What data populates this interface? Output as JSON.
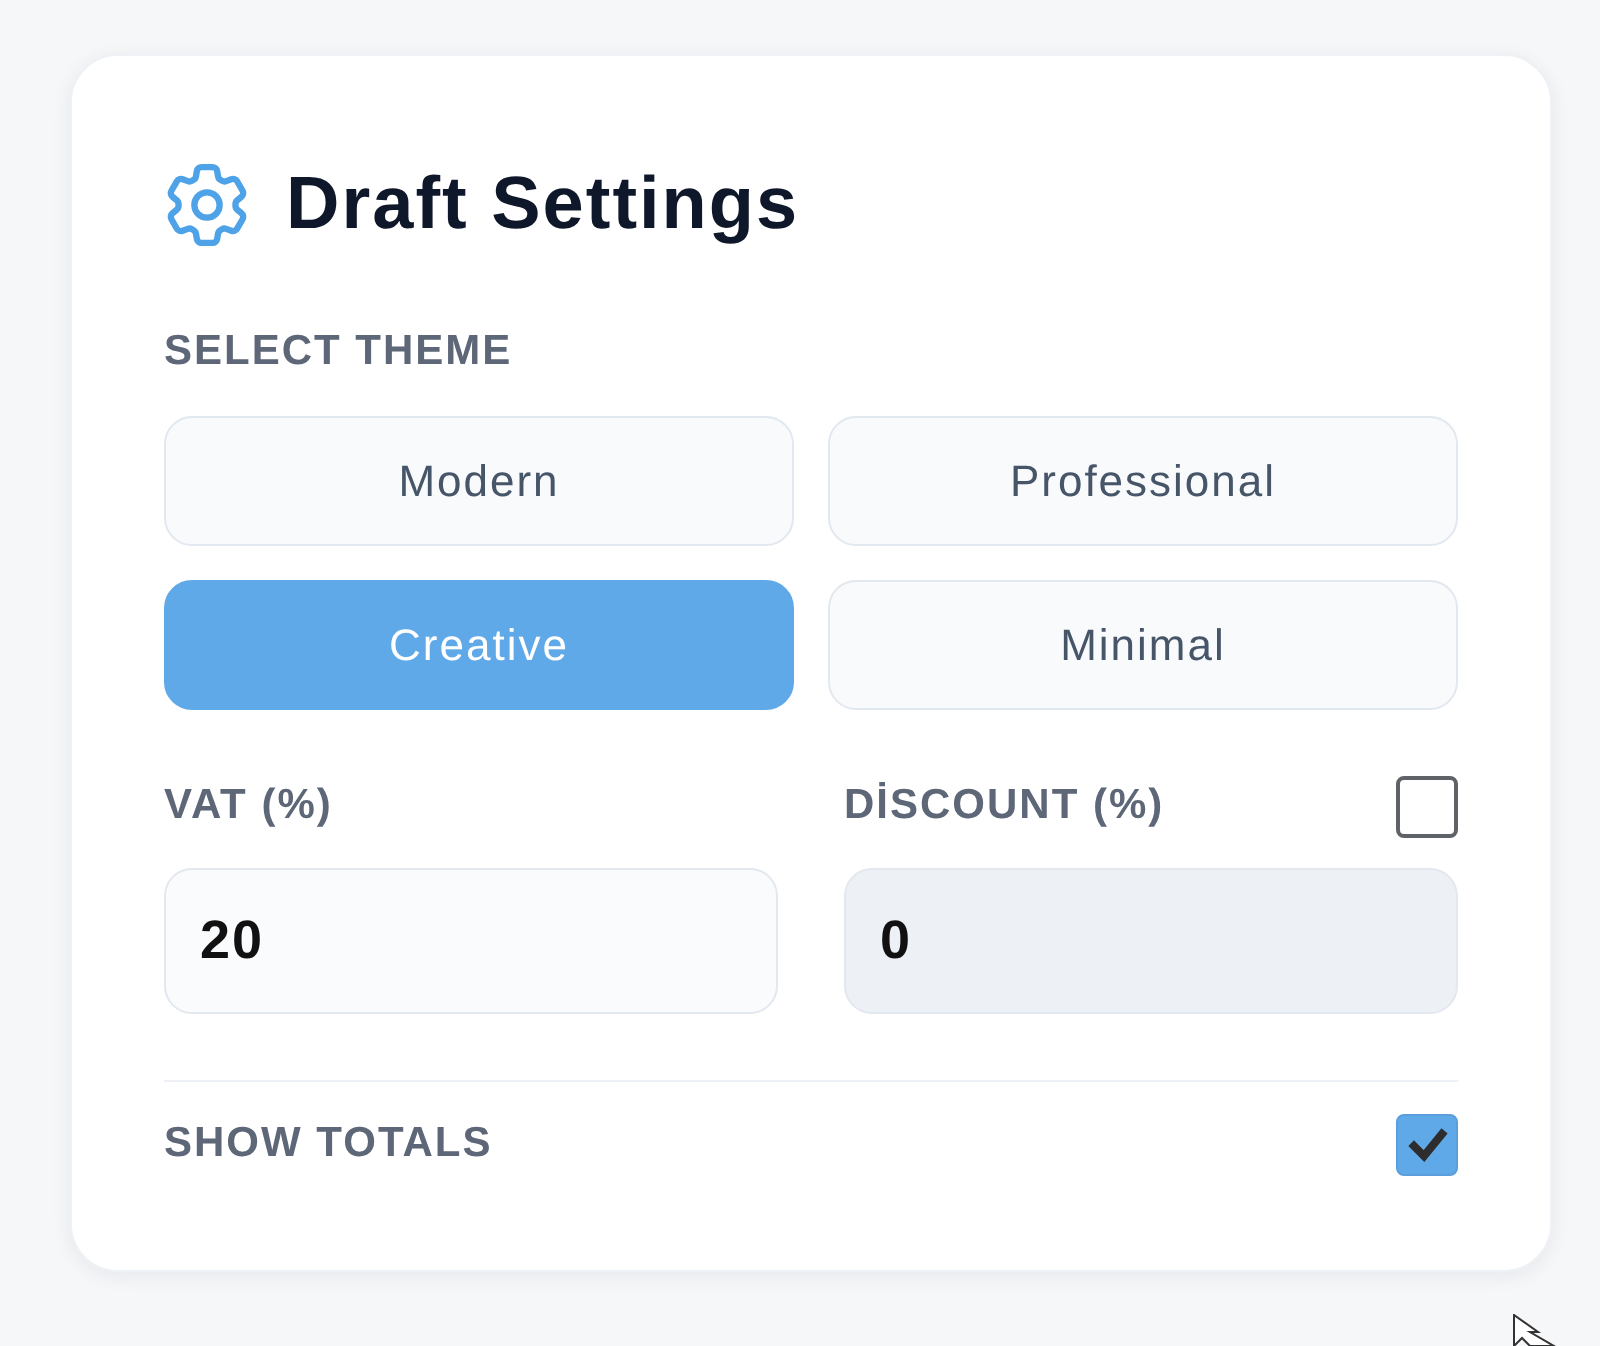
{
  "panel": {
    "title": "Draft Settings"
  },
  "theme": {
    "label": "SELECT THEME",
    "options": [
      {
        "label": "Modern",
        "selected": false
      },
      {
        "label": "Professional",
        "selected": false
      },
      {
        "label": "Creative",
        "selected": true
      },
      {
        "label": "Minimal",
        "selected": false
      }
    ]
  },
  "vat": {
    "label": "VAT (%)",
    "value": "20"
  },
  "discount": {
    "label": "DİSCOUNT (%)",
    "checked": false,
    "value": "0",
    "disabled": true
  },
  "show_totals": {
    "label": "SHOW TOTALS",
    "checked": true
  }
}
